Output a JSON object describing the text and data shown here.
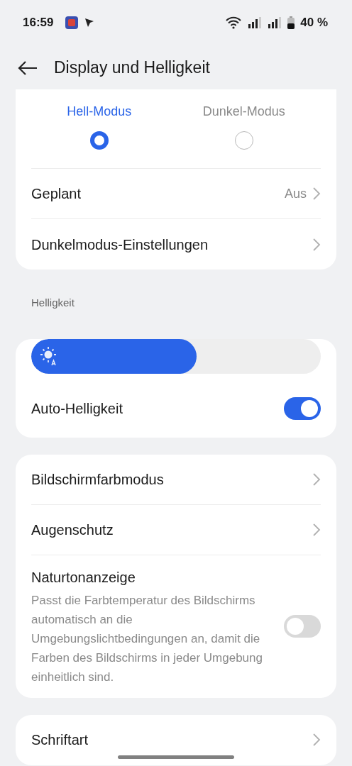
{
  "status_bar": {
    "time": "16:59",
    "battery": "40 %"
  },
  "header": {
    "title": "Display und Helligkeit"
  },
  "theme_modes": [
    {
      "label": "Hell-Modus",
      "selected": true
    },
    {
      "label": "Dunkel-Modus",
      "selected": false
    }
  ],
  "theme_rows": [
    {
      "kind": "nav",
      "label": "Geplant",
      "value": "Aus"
    },
    {
      "kind": "nav",
      "label": "Dunkelmodus-Einstellungen"
    }
  ],
  "brightness": {
    "section_label": "Helligkeit",
    "level": 0.57,
    "auto": {
      "label": "Auto-Helligkeit",
      "on": true
    }
  },
  "display_rows": [
    {
      "kind": "nav",
      "label": "Bildschirmfarbmodus"
    },
    {
      "kind": "nav",
      "label": "Augenschutz"
    },
    {
      "kind": "toggle",
      "label": "Naturtonanzeige",
      "description": "Passt die Farbtemperatur des Bildschirms automatisch an die Umgebungslichtbedingungen an, damit die Farben des Bildschirms in jeder Umgebung einheitlich sind.",
      "on": false
    }
  ],
  "font_rows": [
    {
      "kind": "nav",
      "label": "Schriftart"
    }
  ]
}
